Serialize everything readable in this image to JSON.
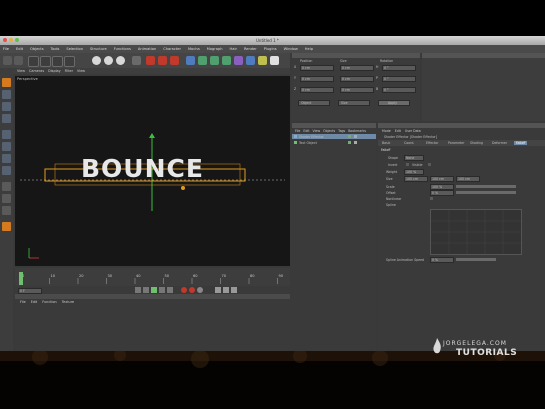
{
  "window": {
    "title": "Untitled 1 *"
  },
  "menu": [
    "File",
    "Edit",
    "Objects",
    "Tools",
    "Selection",
    "Structure",
    "Functions",
    "Animation",
    "Character",
    "Mocha",
    "Mograph",
    "Hair",
    "Render",
    "Plugins",
    "Window",
    "Help"
  ],
  "viewport": {
    "menu": [
      "View",
      "Cameras",
      "Display",
      "Filter",
      "View"
    ],
    "label": "Perspective",
    "scene_text": "BOUNCE"
  },
  "timeline": {
    "ticks": [
      "0",
      "10",
      "20",
      "30",
      "40",
      "50",
      "60",
      "70",
      "80",
      "90"
    ],
    "current": "0 F"
  },
  "material": {
    "tabs": [
      "File",
      "Edit",
      "Function",
      "Texture"
    ]
  },
  "coordinates": {
    "headers": {
      "position": "Position",
      "size": "Size",
      "rotation": "Rotation"
    },
    "rows": [
      {
        "axis": "X",
        "pos": "0 cm",
        "size": "0 cm",
        "rotlabel": "H",
        "rot": "0 °"
      },
      {
        "axis": "Y",
        "pos": "0 cm",
        "size": "0 cm",
        "rotlabel": "P",
        "rot": "0 °"
      },
      {
        "axis": "Z",
        "pos": "0 cm",
        "size": "0 cm",
        "rotlabel": "B",
        "rot": "0 °"
      }
    ],
    "mode": "Object",
    "size_mode": "Size",
    "apply": "Apply"
  },
  "objects": {
    "menu": [
      "File",
      "Edit",
      "View",
      "Objects",
      "Tags",
      "Bookmarks"
    ],
    "items": [
      {
        "name": "Shader Effector"
      },
      {
        "name": "Text Object"
      }
    ]
  },
  "attributes": {
    "menu": [
      "Mode",
      "Edit",
      "User Data"
    ],
    "title": "Shader Effector [Shader Effector]",
    "tabs": [
      "Basic",
      "Coord.",
      "Effector",
      "Parameter",
      "Shading",
      "Deformer",
      "Falloff"
    ],
    "section": "Falloff",
    "shape": {
      "label": "Shape",
      "value": "None"
    },
    "invert": "Invert",
    "visible": "Visible",
    "weight": {
      "label": "Weight",
      "value": "100 %"
    },
    "size": {
      "label": "Size",
      "x": "100 cm",
      "y": "100 cm",
      "z": "100 cm"
    },
    "scale": {
      "label": "Scale",
      "value": "100 %"
    },
    "offset": {
      "label": "Offset",
      "value": "0 %"
    },
    "nonlinear": "Nonlinear",
    "spline": "Spline",
    "anim_speed": {
      "label": "Spline Animation Speed",
      "value": "0 %"
    }
  },
  "watermark": {
    "line1": "JORGELEGA.COM",
    "line2": "TUTORIALS"
  },
  "colors": {
    "accent": "#f08a00",
    "highlight": "#6f8aa6"
  }
}
